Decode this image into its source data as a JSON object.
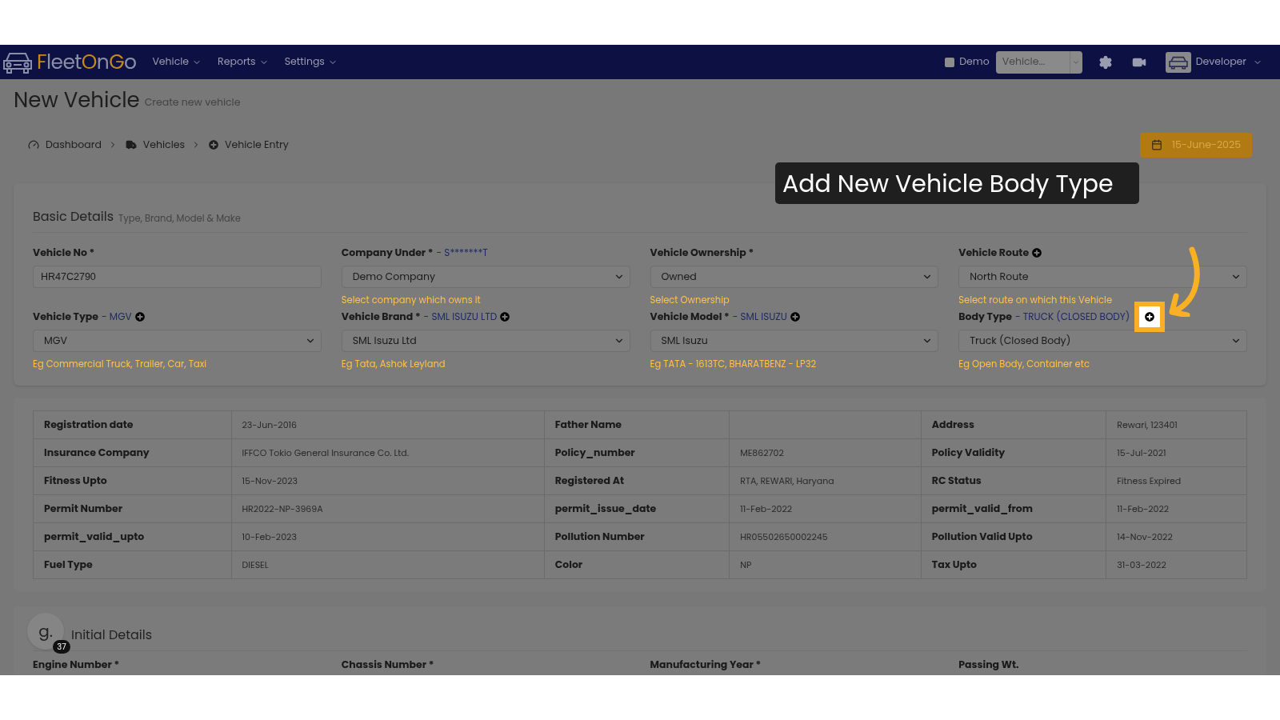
{
  "navbar": {
    "logo": [
      {
        "text": "F",
        "accent": true
      },
      {
        "text": "leet",
        "accent": false
      },
      {
        "text": "O",
        "accent": true
      },
      {
        "text": "n",
        "accent": false
      },
      {
        "text": "G",
        "accent": true
      },
      {
        "text": "o",
        "accent": false
      }
    ],
    "menus": [
      {
        "label": "Vehicle"
      },
      {
        "label": "Reports"
      },
      {
        "label": "Settings"
      }
    ],
    "demo": {
      "label": "Demo",
      "checked": false
    },
    "vehicle_select": {
      "value": "Vehicle..."
    },
    "user": {
      "name": "Developer"
    }
  },
  "page": {
    "title": "New Vehicle",
    "subtitle": "Create new vehicle"
  },
  "breadcrumb": [
    {
      "label": "Dashboard",
      "kind": "dashboard"
    },
    {
      "label": "Vehicles",
      "kind": "vehicles"
    },
    {
      "label": "Vehicle Entry",
      "kind": "entry"
    }
  ],
  "date_badge": "15-June-2025",
  "tooltip": "Add New Vehicle Body Type",
  "basic_details": {
    "title": "Basic Details",
    "subtitle": "Type, Brand, Model & Make",
    "fields": [
      {
        "label": "Vehicle No *",
        "kind": "input",
        "value": "HR47C2790",
        "add": false,
        "highlighted": false
      },
      {
        "label": "Company Under *",
        "note": "- S*******T",
        "kind": "select",
        "value": "Demo Company",
        "hint": "Select company which owns it",
        "add": false,
        "highlighted": false
      },
      {
        "label": "Vehicle Ownership *",
        "kind": "select",
        "value": "Owned",
        "hint": "Select Ownership",
        "add": false,
        "highlighted": false
      },
      {
        "label": "Vehicle Route",
        "kind": "select",
        "value": "North Route",
        "hint": "Select route on which this Vehicle",
        "add": true,
        "highlighted": false
      },
      {
        "label": "Vehicle Type",
        "note": "- MGV",
        "kind": "select",
        "value": "MGV",
        "hint": "Eg Commercial Truck, Trailer, Car, Taxi",
        "add": true,
        "highlighted": false
      },
      {
        "label": "Vehicle Brand *",
        "note": "- SML ISUZU LTD",
        "kind": "select",
        "value": "SML Isuzu Ltd",
        "hint": "Eg Tata, Ashok Leyland",
        "add": true,
        "highlighted": false
      },
      {
        "label": "Vehicle Model *",
        "note": "- SML ISUZU",
        "kind": "select",
        "value": "SML Isuzu",
        "hint": "Eg TATA - 1613TC, BHARATBENZ - LP32",
        "add": true,
        "highlighted": false
      },
      {
        "label": "Body Type",
        "note": "- TRUCK (CLOSED BODY)",
        "kind": "select",
        "value": "Truck (Closed Body)",
        "hint": "Eg Open Body, Container etc",
        "add": true,
        "highlighted": true
      }
    ]
  },
  "details_table": {
    "rows": [
      [
        "Registration date",
        "23-Jun-2016",
        "Father Name",
        "",
        "Address",
        "Rewari, 123401"
      ],
      [
        "Insurance Company",
        "IFFCO Tokio General Insurance Co. Ltd.",
        "Policy_number",
        "ME862702",
        "Policy Validity",
        "15-Jul-2021"
      ],
      [
        "Fitness Upto",
        "15-Nov-2023",
        "Registered At",
        "RTA, REWARI, Haryana",
        "RC Status",
        "Fitness Expired"
      ],
      [
        "Permit Number",
        "HR2022-NP-3969A",
        "permit_issue_date",
        "11-Feb-2022",
        "permit_valid_from",
        "11-Feb-2022"
      ],
      [
        "permit_valid_upto",
        "10-Feb-2023",
        "Pollution Number",
        "HR05502650002245",
        "Pollution Valid Upto",
        "14-Nov-2022"
      ],
      [
        "Fuel Type",
        "DIESEL",
        "Color",
        "NP",
        "Tax Upto",
        "31-03-2022"
      ]
    ]
  },
  "initial_details": {
    "title": "Initial Details",
    "fields": [
      "Engine Number *",
      "Chassis Number *",
      "Manufacturing Year *",
      "Passing Wt."
    ]
  },
  "help_bubble": {
    "letter": "g.",
    "badge": "37"
  }
}
